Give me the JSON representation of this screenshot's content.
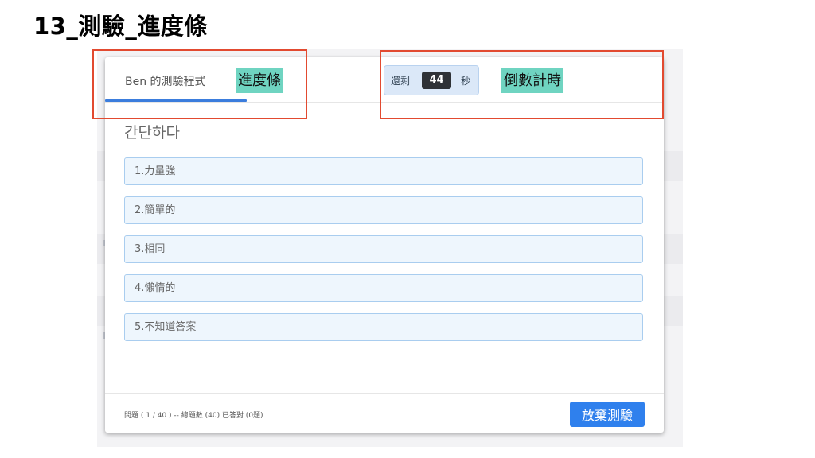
{
  "slide": {
    "title": "13_測驗_進度條"
  },
  "modal": {
    "quiz_title": "Ben 的測驗程式",
    "timer": {
      "prefix": "還剩",
      "count": "44",
      "suffix": "秒"
    },
    "question": "간단하다",
    "options": [
      "1.力量強",
      "2.簡單的",
      "3.相同",
      "4.懶惰的",
      "5.不知道答案"
    ],
    "footer_status": "問題 ( 1 / 40 ) -- 總題數 (40) 已答對 (0題)",
    "quit_label": "放棄測驗"
  },
  "progress": {
    "fraction": 1.0
  },
  "annotations": {
    "progress_bar": "進度條",
    "countdown": "倒數計時"
  },
  "colors": {
    "accent": "#2f80ed",
    "progress": "#3b7ddd",
    "annotation_border": "#e24a30",
    "annotation_tag": "#6fd4c1",
    "option_bg": "#eef6fd"
  }
}
